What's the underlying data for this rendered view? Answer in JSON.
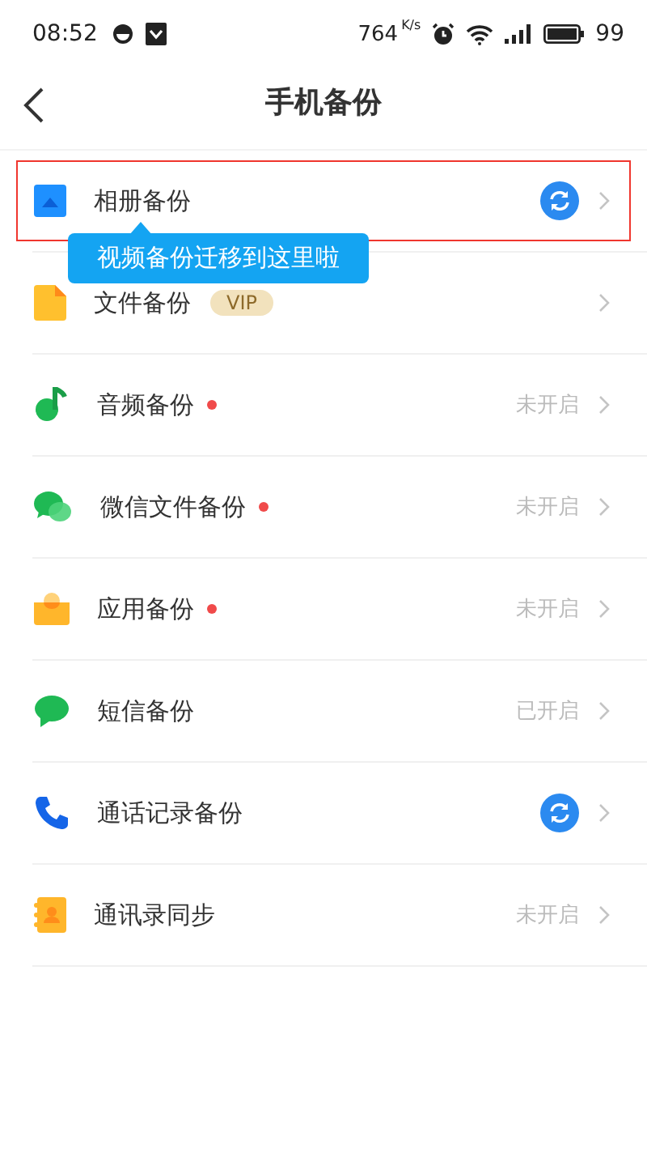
{
  "status_bar": {
    "time": "08:52",
    "speed": "764",
    "speed_unit": "K/s",
    "battery": "99"
  },
  "header": {
    "title": "手机备份"
  },
  "items": [
    {
      "label": "相册备份",
      "dot": false,
      "highlighted": true,
      "kind": "sync"
    },
    {
      "label": "文件备份",
      "badge": "VIP",
      "dot": false,
      "highlighted": false,
      "kind": "arrow"
    },
    {
      "label": "音频备份",
      "dot": true,
      "highlighted": false,
      "kind": "status",
      "status": "未开启"
    },
    {
      "label": "微信文件备份",
      "dot": true,
      "highlighted": false,
      "kind": "status",
      "status": "未开启"
    },
    {
      "label": "应用备份",
      "dot": true,
      "highlighted": false,
      "kind": "status",
      "status": "未开启"
    },
    {
      "label": "短信备份",
      "dot": false,
      "highlighted": false,
      "kind": "status",
      "status": "已开启"
    },
    {
      "label": "通话记录备份",
      "dot": false,
      "highlighted": false,
      "kind": "sync"
    },
    {
      "label": "通讯录同步",
      "dot": false,
      "highlighted": false,
      "kind": "status",
      "status": "未开启"
    }
  ],
  "tooltip": {
    "text": "视频备份迁移到这里啦"
  }
}
